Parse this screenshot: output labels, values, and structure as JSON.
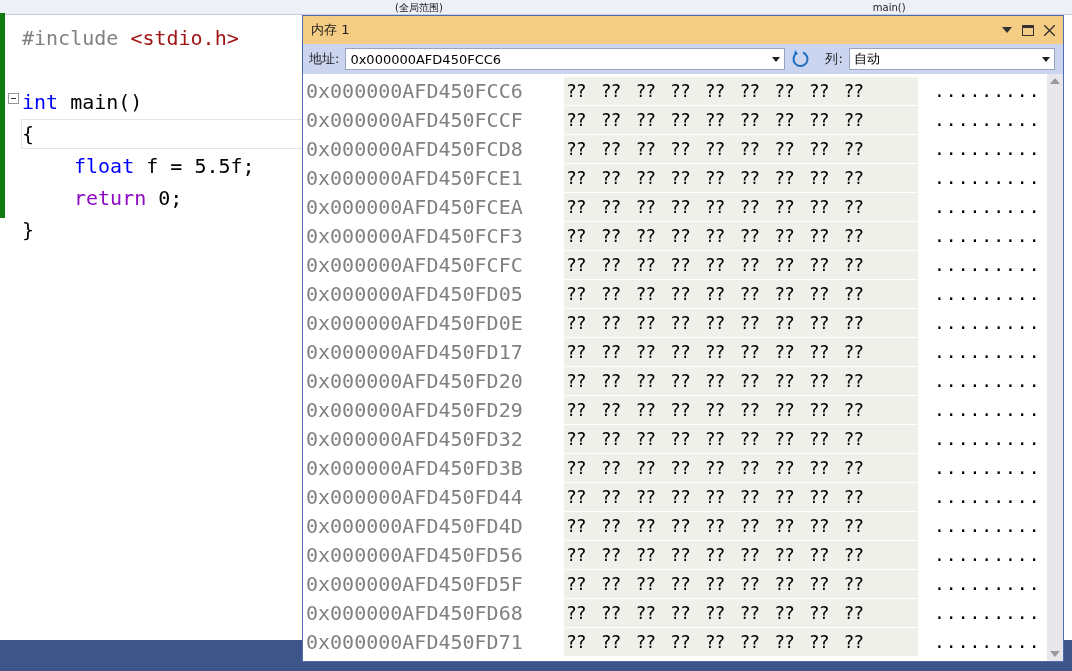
{
  "top_bar": {
    "scope": "(全局范围)",
    "function": "main()"
  },
  "editor": {
    "lines": [
      {
        "tokens": [
          {
            "text": "#include ",
            "kind": "preprocessor"
          },
          {
            "text": "<stdio.h>",
            "kind": "string"
          }
        ]
      },
      {
        "blank": true
      },
      {
        "fold": true,
        "tokens": [
          {
            "text": "int",
            "kind": "keyword"
          },
          {
            "text": " main()",
            "kind": "plain"
          }
        ]
      },
      {
        "current": true,
        "tokens": [
          {
            "text": "{",
            "kind": "plain"
          }
        ]
      },
      {
        "indent": true,
        "tokens": [
          {
            "text": "float",
            "kind": "keyword"
          },
          {
            "text": " f = 5.5f;",
            "kind": "plain"
          }
        ]
      },
      {
        "indent": true,
        "tokens": [
          {
            "text": "return",
            "kind": "control"
          },
          {
            "text": " 0;",
            "kind": "plain"
          }
        ]
      },
      {
        "tokens": [
          {
            "text": "}",
            "kind": "plain"
          }
        ]
      }
    ]
  },
  "memory_window": {
    "title": "内存 1",
    "address_label": "地址:",
    "address": "0x000000AFD450FCC6",
    "columns_label": "列:",
    "columns": "自动",
    "rows": [
      {
        "address": "0x000000AFD450FCC6",
        "bytes": [
          "??",
          "??",
          "??",
          "??",
          "??",
          "??",
          "??",
          "??",
          "??"
        ],
        "ascii": "........."
      },
      {
        "address": "0x000000AFD450FCCF",
        "bytes": [
          "??",
          "??",
          "??",
          "??",
          "??",
          "??",
          "??",
          "??",
          "??"
        ],
        "ascii": "........."
      },
      {
        "address": "0x000000AFD450FCD8",
        "bytes": [
          "??",
          "??",
          "??",
          "??",
          "??",
          "??",
          "??",
          "??",
          "??"
        ],
        "ascii": "........."
      },
      {
        "address": "0x000000AFD450FCE1",
        "bytes": [
          "??",
          "??",
          "??",
          "??",
          "??",
          "??",
          "??",
          "??",
          "??"
        ],
        "ascii": "........."
      },
      {
        "address": "0x000000AFD450FCEA",
        "bytes": [
          "??",
          "??",
          "??",
          "??",
          "??",
          "??",
          "??",
          "??",
          "??"
        ],
        "ascii": "........."
      },
      {
        "address": "0x000000AFD450FCF3",
        "bytes": [
          "??",
          "??",
          "??",
          "??",
          "??",
          "??",
          "??",
          "??",
          "??"
        ],
        "ascii": "........."
      },
      {
        "address": "0x000000AFD450FCFC",
        "bytes": [
          "??",
          "??",
          "??",
          "??",
          "??",
          "??",
          "??",
          "??",
          "??"
        ],
        "ascii": "........."
      },
      {
        "address": "0x000000AFD450FD05",
        "bytes": [
          "??",
          "??",
          "??",
          "??",
          "??",
          "??",
          "??",
          "??",
          "??"
        ],
        "ascii": "........."
      },
      {
        "address": "0x000000AFD450FD0E",
        "bytes": [
          "??",
          "??",
          "??",
          "??",
          "??",
          "??",
          "??",
          "??",
          "??"
        ],
        "ascii": "........."
      },
      {
        "address": "0x000000AFD450FD17",
        "bytes": [
          "??",
          "??",
          "??",
          "??",
          "??",
          "??",
          "??",
          "??",
          "??"
        ],
        "ascii": "........."
      },
      {
        "address": "0x000000AFD450FD20",
        "bytes": [
          "??",
          "??",
          "??",
          "??",
          "??",
          "??",
          "??",
          "??",
          "??"
        ],
        "ascii": "........."
      },
      {
        "address": "0x000000AFD450FD29",
        "bytes": [
          "??",
          "??",
          "??",
          "??",
          "??",
          "??",
          "??",
          "??",
          "??"
        ],
        "ascii": "........."
      },
      {
        "address": "0x000000AFD450FD32",
        "bytes": [
          "??",
          "??",
          "??",
          "??",
          "??",
          "??",
          "??",
          "??",
          "??"
        ],
        "ascii": "........."
      },
      {
        "address": "0x000000AFD450FD3B",
        "bytes": [
          "??",
          "??",
          "??",
          "??",
          "??",
          "??",
          "??",
          "??",
          "??"
        ],
        "ascii": "........."
      },
      {
        "address": "0x000000AFD450FD44",
        "bytes": [
          "??",
          "??",
          "??",
          "??",
          "??",
          "??",
          "??",
          "??",
          "??"
        ],
        "ascii": "........."
      },
      {
        "address": "0x000000AFD450FD4D",
        "bytes": [
          "??",
          "??",
          "??",
          "??",
          "??",
          "??",
          "??",
          "??",
          "??"
        ],
        "ascii": "........."
      },
      {
        "address": "0x000000AFD450FD56",
        "bytes": [
          "??",
          "??",
          "??",
          "??",
          "??",
          "??",
          "??",
          "??",
          "??"
        ],
        "ascii": "........."
      },
      {
        "address": "0x000000AFD450FD5F",
        "bytes": [
          "??",
          "??",
          "??",
          "??",
          "??",
          "??",
          "??",
          "??",
          "??"
        ],
        "ascii": "........."
      },
      {
        "address": "0x000000AFD450FD68",
        "bytes": [
          "??",
          "??",
          "??",
          "??",
          "??",
          "??",
          "??",
          "??",
          "??"
        ],
        "ascii": "........."
      },
      {
        "address": "0x000000AFD450FD71",
        "bytes": [
          "??",
          "??",
          "??",
          "??",
          "??",
          "??",
          "??",
          "??",
          "??"
        ],
        "ascii": "........."
      }
    ]
  }
}
